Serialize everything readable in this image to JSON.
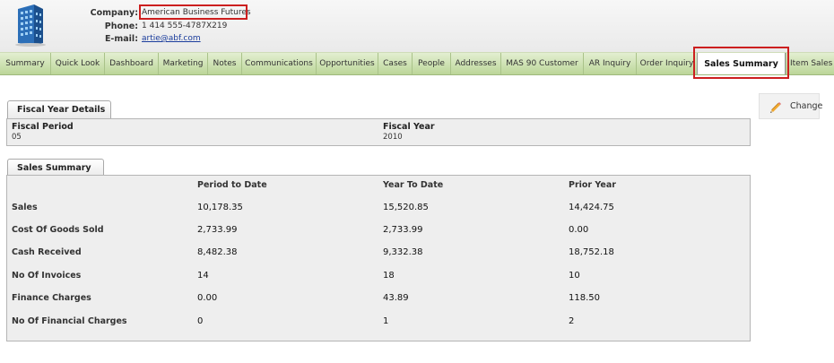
{
  "header": {
    "company_label": "Company:",
    "company_value": "American Business Futures",
    "phone_label": "Phone:",
    "phone_value": "1 414 555-4787X219",
    "email_label": "E-mail:",
    "email_value": "artie@abf.com",
    "logo_icon": "office-building-icon"
  },
  "tabs": [
    {
      "label": "Summary"
    },
    {
      "label": "Quick Look"
    },
    {
      "label": "Dashboard"
    },
    {
      "label": "Marketing"
    },
    {
      "label": "Notes"
    },
    {
      "label": "Communications"
    },
    {
      "label": "Opportunities"
    },
    {
      "label": "Cases"
    },
    {
      "label": "People"
    },
    {
      "label": "Addresses"
    },
    {
      "label": "MAS 90 Customer"
    },
    {
      "label": "AR Inquiry"
    },
    {
      "label": "Order Inquiry"
    },
    {
      "label": "Sales Summary",
      "active": true
    },
    {
      "label": "Item Sales H"
    }
  ],
  "fiscal": {
    "title": "Fiscal Year Details",
    "period_label": "Fiscal Period",
    "period_value": "05",
    "year_label": "Fiscal Year",
    "year_value": "2010"
  },
  "summary": {
    "title": "Sales Summary",
    "columns": [
      "Period to Date",
      "Year To Date",
      "Prior Year"
    ],
    "rows": [
      {
        "label": "Sales",
        "values": [
          "10,178.35",
          "15,520.85",
          "14,424.75"
        ]
      },
      {
        "label": "Cost Of Goods Sold",
        "values": [
          "2,733.99",
          "2,733.99",
          "0.00"
        ]
      },
      {
        "label": "Cash Received",
        "values": [
          "8,482.38",
          "9,332.38",
          "18,752.18"
        ]
      },
      {
        "label": "No Of Invoices",
        "values": [
          "14",
          "18",
          "10"
        ]
      },
      {
        "label": "Finance Charges",
        "values": [
          "0.00",
          "43.89",
          "118.50"
        ]
      },
      {
        "label": "No Of Financial Charges",
        "values": [
          "0",
          "1",
          "2"
        ]
      }
    ]
  },
  "change_button": {
    "label": "Change",
    "icon": "pencil-icon"
  },
  "colors": {
    "highlight_red": "#cc1f1f",
    "tab_green": "#c9e0ab",
    "link_blue": "#1a3c9c"
  }
}
